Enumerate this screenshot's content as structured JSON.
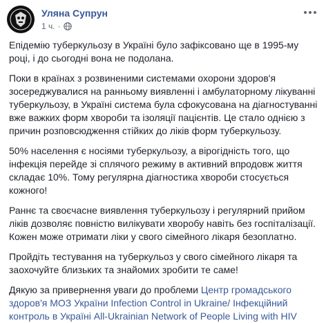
{
  "post": {
    "author": "Уляна Супрун",
    "time": "1 ч.",
    "separator": "·",
    "paragraphs": [
      "Епідемію туберкульозу в Україні було зафіксовано ще в 1995-му році, і до сьогодні вона не подолана.",
      "Поки в країнах з розвиненими системами охорони здоров'я зосереджувалися на ранньому виявленні і амбулаторному лікуванні туберкульозу, в Україні система була сфокусована на діагностуванні вже важких форм хвороби та ізоляції пацієнтів. Це стало однією з причин розповсюдження стійких до ліків форм туберкульозу.",
      "50% населення є носіями туберкульозу, а вірогідність того, що інфекція перейде зі сплячого режиму в активний впродовж життя складає 10%. Тому регулярна діагностика хвороби стосується кожного!",
      "Раннє та своєчасне виявлення туберкульозу і регулярний прийом ліків дозволяє повністю вилікувати хворобу навіть без госпіталізації. Кожен може отримати ліки у свого сімейного лікаря безоплатно.",
      "Пройдіть тестування на туберкульоз у свого сімейного лікаря та заохочуйте близьких та знайомих зробити те саме!"
    ],
    "thanks_prefix": "Дякую за привернення уваги до проблеми ",
    "thanks_links": [
      "Центр громадського здоров'я МОЗ України",
      "Infection Control in Ukraine/ Інфекційний контроль в Україні",
      "All-Ukrainian Network of People Living with HIV"
    ]
  },
  "icons": {
    "avatar": "profile-avatar",
    "privacy": "globe-icon",
    "options": "more-options-icon"
  },
  "colors": {
    "link": "#385898",
    "text": "#1d2129",
    "muted": "#606770"
  }
}
